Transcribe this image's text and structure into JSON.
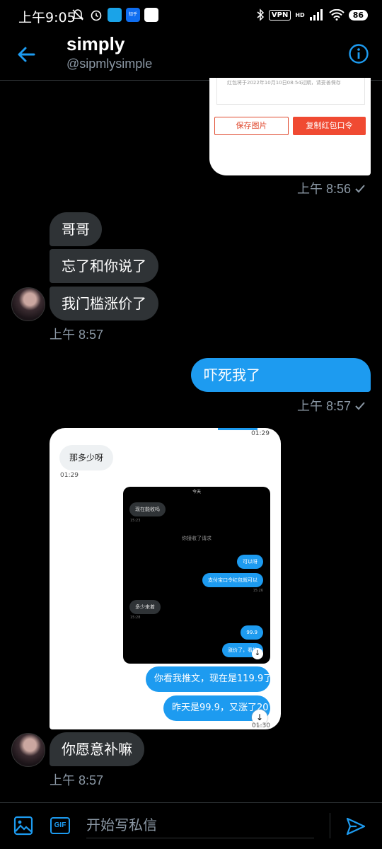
{
  "status_bar": {
    "time": "上午9:05",
    "vpn": "VPN",
    "hd": "HD",
    "battery": "86",
    "app_icon_zhihu": "知乎"
  },
  "header": {
    "name": "simply",
    "handle": "@sipmlysimple",
    "back_icon": "arrow-left-icon",
    "info_icon": "info-icon"
  },
  "card1": {
    "tail_text": "红包将于2022年10月10日08:54过期，请妥善保存",
    "save_label": "保存图片",
    "copy_label": "复制红包口令"
  },
  "messages": {
    "out1_time": "上午 8:56",
    "in1": "哥哥",
    "in2": "忘了和你说了",
    "in3": "我门槛涨价了",
    "in_group_time": "上午 8:57",
    "out2": "吓死我了",
    "out2_time": "上午 8:57",
    "in4": "你愿意补嘛",
    "in4_time": "上午 8:57"
  },
  "card2": {
    "top_time": "01:29",
    "bubble": "那多少呀",
    "bubble_time": "01:29",
    "inner": {
      "header": "今天",
      "b1": "现在能收吗",
      "t1": "15:23",
      "sys": "你接收了请求",
      "b2": "可以呀",
      "b3": "支付宝口令红包就可以",
      "t3": "15:26",
      "b4": "多少来着",
      "t4": "15:28",
      "b5": "99.9",
      "b6": "涨价了，看推"
    },
    "blue1": "你看我推文，现在是119.9了",
    "blue2": "昨天是99.9，又涨了20",
    "blue_time": "01:30"
  },
  "composer": {
    "placeholder": "开始写私信",
    "gif_label": "GIF"
  },
  "colors": {
    "accent": "#1d9bf0",
    "bubble_in": "#2f3336",
    "muted": "#8b98a5",
    "red": "#f04a32"
  }
}
